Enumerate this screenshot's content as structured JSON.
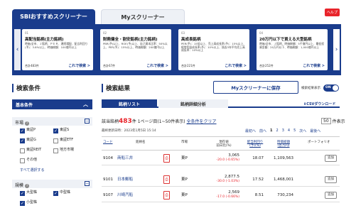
{
  "top_tabs": {
    "active": "SBIおすすめスクリーナー",
    "other": "Myスクリーナー",
    "help": "ヘルプ"
  },
  "cards": [
    {
      "num": "01",
      "title": "高配当銘柄(主力銘柄)",
      "desc": "時価/全市、Ｊ銘柄、ＰＥＲ、連続増配、配当利回り(予)：3.8%以上、時価総額：100億円以上",
      "count": "合計483件",
      "go": "これで検索 >"
    },
    {
      "num": "02",
      "title": "財務健全・割安銘柄(主力銘柄)",
      "desc": "PBR(予)以上、ROE(予)以上、自己資本比率：50%以上、PER(予)：15%以上、時価総額：200億円以上",
      "count": "合計67件",
      "go": "これで検索 >"
    },
    {
      "num": "03",
      "title": "高成長銘柄",
      "desc": "PER(予)：15倍以上、売上高成長率(予)：15%以上、経常利益成長率(予)：10%以上、過去3年平均売上高成長率：10%以上",
      "count": "合計221件",
      "go": "これで検索 >"
    },
    {
      "num": "04",
      "title": "20万円以下で買える大型銘柄",
      "desc": "時価/全市、Ｊ銘柄、時価総額：5千億円以上、最低投資金額：20万円以下、時価総額：1,000億円以上",
      "count": "合計252件",
      "go": "これで検索 >"
    }
  ],
  "left": {
    "header": "検索条件",
    "basic": "基本条件",
    "market": {
      "label": "市場",
      "items": [
        {
          "label": "東証P",
          "on": true
        },
        {
          "label": "東証S",
          "on": true
        },
        {
          "label": "東証G",
          "on": true
        },
        {
          "label": "東証ETF",
          "on": false
        },
        {
          "label": "東証REIT",
          "on": false
        },
        {
          "label": "地方市場",
          "on": false
        },
        {
          "label": "その他",
          "on": false
        }
      ],
      "select_all": "すべて選択する"
    },
    "size": {
      "label": "規模",
      "items": [
        {
          "label": "大型株",
          "on": true
        },
        {
          "label": "中型株",
          "on": true
        },
        {
          "label": "小型株",
          "on": true
        }
      ]
    }
  },
  "right": {
    "header": "検索結果",
    "save": "Myスクリーナーに保存",
    "display_label": "検索結果表示",
    "toggle": "ON",
    "tabs": [
      "銘柄リスト",
      "銘柄詳細分析"
    ],
    "csv": "⬇CSVダウンロード",
    "hits_pre": "該当銘柄",
    "hits_num": "483",
    "hits_post": "件 1ページ目(1~50件表示)",
    "clear": "全条件をクリア",
    "per_page": "50",
    "per_page_suffix": "件表示",
    "updated": "最終更新日時：2023年1月5日 15:14",
    "pager": [
      "最初へ",
      "前へ",
      "1",
      "2",
      "3",
      "4",
      "5",
      "次へ",
      "最後へ"
    ],
    "columns": [
      "コード",
      "銘柄名",
      "市場",
      "現在値\n前日比(%)",
      "配当利回り\n(予)(%)",
      "時価総額\n(百万円)",
      "ポートフォリオ"
    ],
    "rows": [
      {
        "code": "9104",
        "name": "商船三井",
        "market": "東P",
        "price": "3,065",
        "chg": "-20.0 (-0.65%)",
        "yield": "18.07",
        "cap": "1,109,563",
        "add": "追加"
      },
      {
        "code": "9101",
        "name": "日本郵船",
        "market": "東P",
        "price": "2,877.5",
        "chg": "-30.0 (-1.03%)",
        "yield": "17.52",
        "cap": "1,468,001",
        "add": "追加"
      },
      {
        "code": "9107",
        "name": "川崎汽船",
        "market": "東P",
        "price": "2,569",
        "chg": "-17.0 (-0.66%)",
        "yield": "8.51",
        "cap": "730,234",
        "add": "追加"
      }
    ]
  }
}
